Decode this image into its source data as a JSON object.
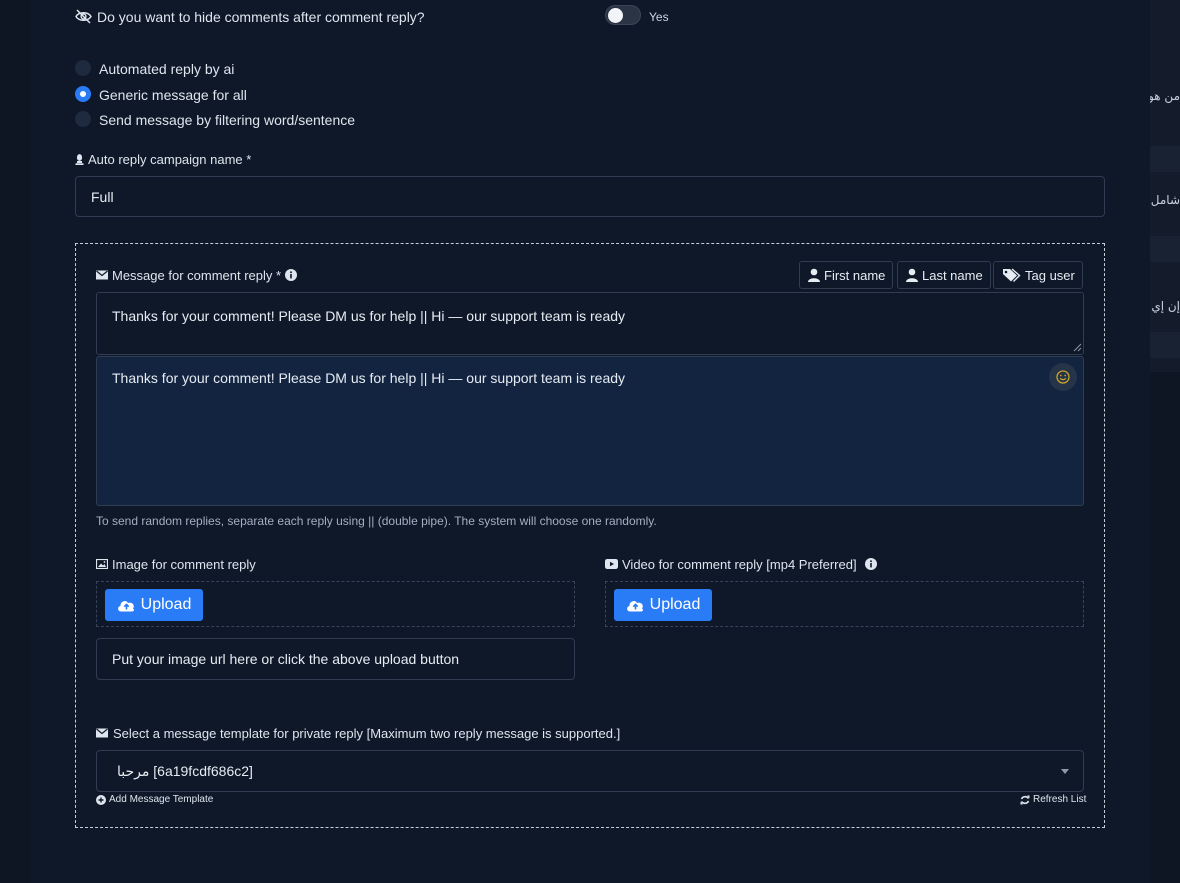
{
  "background_right": {
    "texts": [
      "من هو",
      "شامل",
      "إن إي"
    ]
  },
  "hide_comments": {
    "question": "Do you want to hide comments after comment reply?",
    "toggle_label": "Yes",
    "toggle_on": false
  },
  "reply_type": {
    "options": [
      {
        "label": "Automated reply by ai",
        "selected": false
      },
      {
        "label": "Generic message for all",
        "selected": true
      },
      {
        "label": "Send message by filtering word/sentence",
        "selected": false
      }
    ]
  },
  "campaign": {
    "label": "Auto reply campaign name *",
    "value": "Full"
  },
  "message": {
    "label": "Message for comment reply *",
    "tags": {
      "first_name": "First name",
      "last_name": "Last name",
      "tag_user": "Tag user"
    },
    "text_raw": "Thanks for your comment! Please DM us for help || Hi — our support team is ready",
    "text_editor": "Thanks for your comment! Please DM us for help || Hi — our support team is ready",
    "helper": "To send random replies, separate each reply using || (double pipe). The system will choose one randomly."
  },
  "image": {
    "label": "Image for comment reply",
    "upload_label": "Upload",
    "url_placeholder": "Put your image url here or click the above upload button"
  },
  "video": {
    "label": "Video for comment reply [mp4 Preferred]",
    "upload_label": "Upload"
  },
  "private_reply": {
    "label": "Select a message template for private reply [Maximum two reply message is supported.]",
    "selected": "مرحبا [6a19fcdf686c2]",
    "add_template": "Add Message Template",
    "refresh": "Refresh List"
  },
  "colors": {
    "accent": "#2a7cf6",
    "panel": "#0e1828",
    "page": "#0f1623"
  }
}
